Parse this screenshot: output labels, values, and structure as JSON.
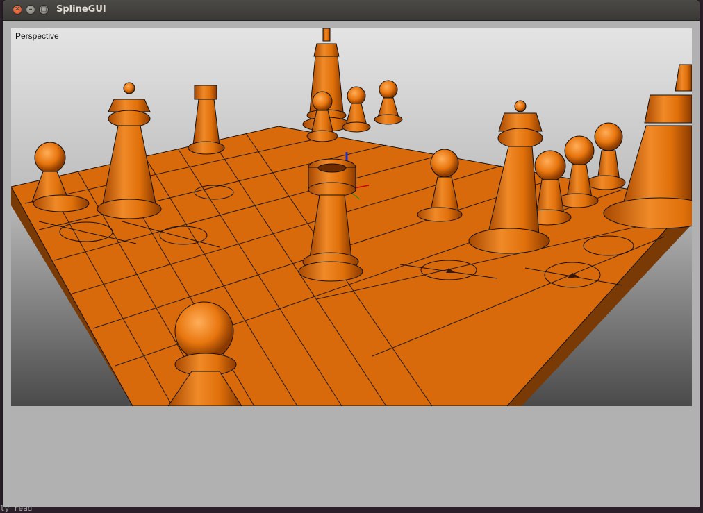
{
  "window": {
    "title": "SplineGUI",
    "close_glyph": "✕",
    "minimize_glyph": "–",
    "maximize_glyph": "▢"
  },
  "viewport": {
    "label": "Perspective",
    "scene_color": "#e0700a"
  },
  "terminal": {
    "text": "ly read"
  }
}
